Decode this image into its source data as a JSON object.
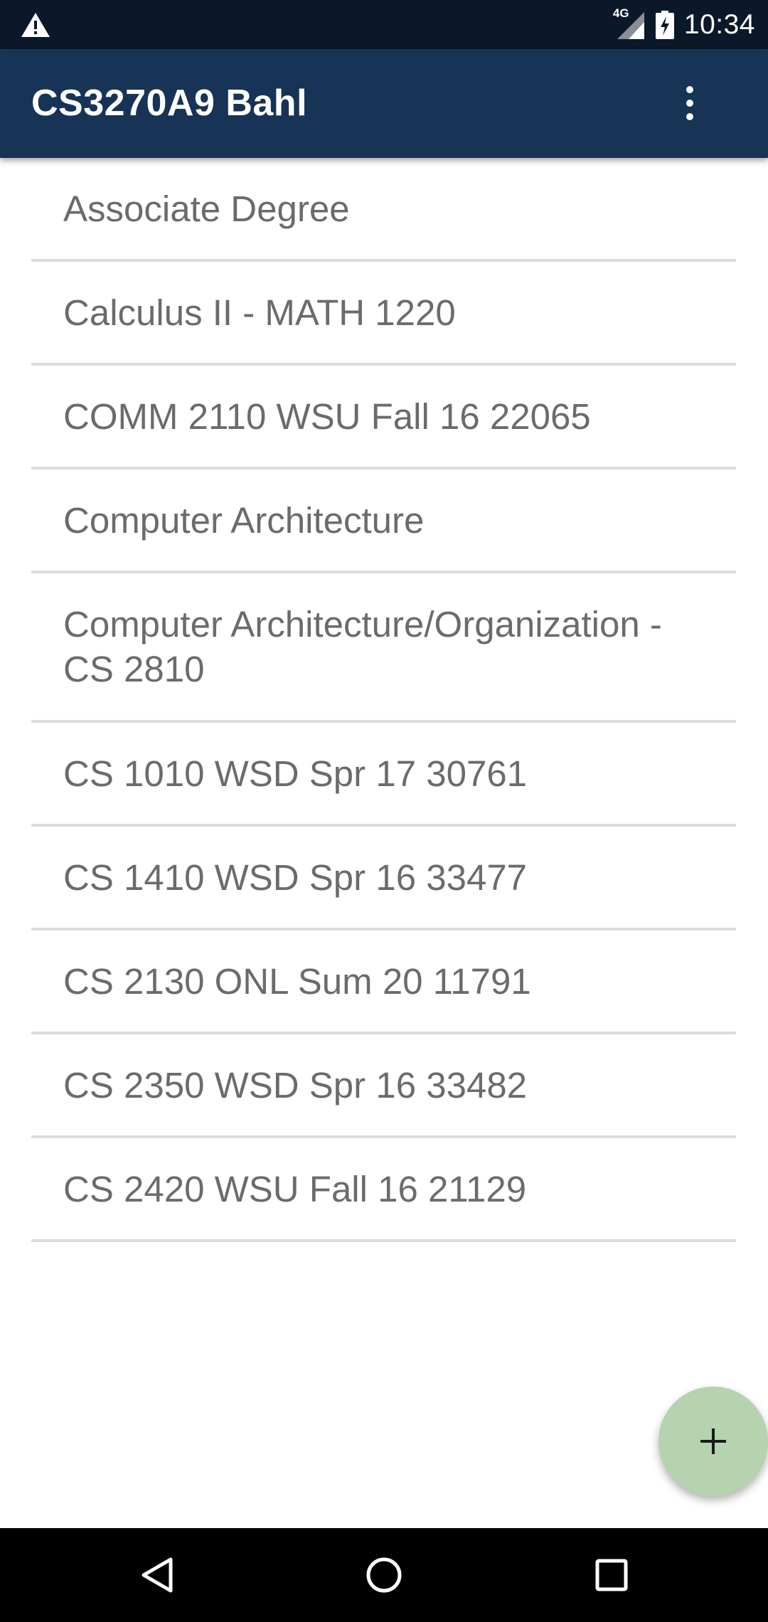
{
  "status_bar": {
    "alert_icon": "warning-triangle-icon",
    "network_label": "4G",
    "signal_icon": "cell-signal-icon",
    "battery_icon": "battery-charging-icon",
    "time": "10:34"
  },
  "app_bar": {
    "title": "CS3270A9 Bahl",
    "menu_icon": "overflow-menu-icon",
    "background_color": "#173355"
  },
  "courses": [
    {
      "label": "Associate Degree"
    },
    {
      "label": "Calculus II - MATH 1220"
    },
    {
      "label": "COMM 2110 WSU Fall 16 22065"
    },
    {
      "label": "Computer Architecture"
    },
    {
      "label": "Computer Architecture/Organization - CS 2810"
    },
    {
      "label": "CS 1010 WSD Spr 17 30761"
    },
    {
      "label": "CS 1410 WSD Spr 16 33477"
    },
    {
      "label": "CS 2130 ONL Sum 20 11791"
    },
    {
      "label": "CS 2350 WSD Spr 16 33482"
    },
    {
      "label": "CS 2420 WSU Fall 16 21129"
    }
  ],
  "fab": {
    "icon": "plus-icon",
    "color": "#b5d3ae"
  },
  "nav_bar": {
    "back_icon": "back-triangle-icon",
    "home_icon": "home-circle-icon",
    "recents_icon": "recents-square-icon"
  }
}
